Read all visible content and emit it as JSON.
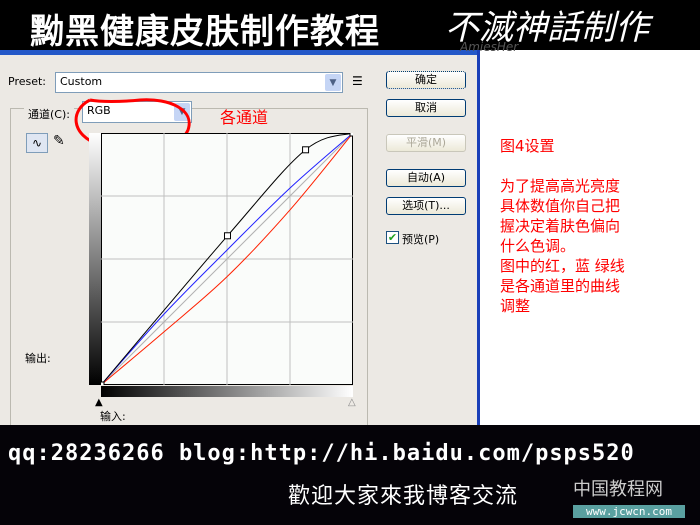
{
  "banner": {
    "title": "黝黑健康皮肤制作教程",
    "logo_text": "不滅神話制作",
    "logo_sub": "AmiesHer"
  },
  "dialog": {
    "preset_label": "Preset:",
    "preset_value": "Custom",
    "channel_label": "通道(C):",
    "channel_value": "RGB",
    "annotation_channels": "各通道",
    "output_label": "输出:",
    "input_label": "输入:",
    "buttons": {
      "ok": "确定",
      "cancel": "取消",
      "smooth": "平滑(M)",
      "auto": "自动(A)",
      "options": "选项(T)..."
    },
    "preview_label": "预览(P)",
    "preview_checked": true
  },
  "curves": {
    "range": [
      0,
      255
    ],
    "rgb": [
      [
        0,
        0
      ],
      [
        128,
        151
      ],
      [
        207,
        238
      ],
      [
        255,
        255
      ]
    ],
    "blue": [
      [
        0,
        0
      ],
      [
        64,
        72
      ],
      [
        128,
        137
      ],
      [
        192,
        200
      ],
      [
        255,
        255
      ]
    ],
    "red": [
      [
        0,
        0
      ],
      [
        64,
        54
      ],
      [
        128,
        110
      ],
      [
        192,
        178
      ],
      [
        255,
        255
      ]
    ],
    "colors": {
      "rgb": "#000000",
      "blue": "#2020ff",
      "red": "#ff2000",
      "diagonal": "#b0b0b0",
      "grid": "#c0c0c0"
    }
  },
  "notes": {
    "lines": [
      "图4设置",
      "",
      "为了提高高光亮度",
      "具体数值你自己把",
      "握决定着肤色偏向",
      "什么色调。",
      "图中的红，蓝 绿线",
      "是各通道里的曲线",
      "调整"
    ]
  },
  "footer": {
    "contact": "qq:28236266  blog:http://hi.baidu.com/psps520",
    "welcome": "歡迎大家來我博客交流",
    "site_name": "中国教程网",
    "site_url": "www.jcwcn.com"
  }
}
